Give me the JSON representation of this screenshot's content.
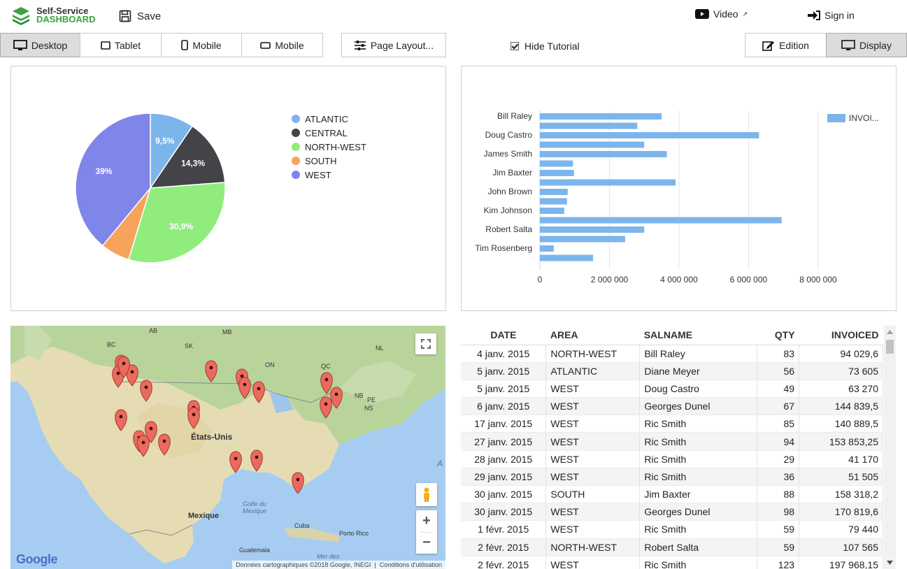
{
  "header": {
    "logo_line1": "Self-Service",
    "logo_line2": "DASHBOARD",
    "save_label": "Save",
    "video_label": "Video",
    "signin_label": "Sign in"
  },
  "toolbar": {
    "desktop": "Desktop",
    "tablet": "Tablet",
    "mobile": "Mobile",
    "mobile2": "Mobile",
    "page_layout": "Page Layout...",
    "hide_tutorial": "Hide Tutorial",
    "edition": "Edition",
    "display": "Display"
  },
  "colors": {
    "accent": "#3aa33f",
    "bar": "#7cb5ec"
  },
  "pie": {
    "legend": [
      {
        "label": "ATLANTIC",
        "color": "#7cb5ec"
      },
      {
        "label": "CENTRAL",
        "color": "#434348"
      },
      {
        "label": "NORTH-WEST",
        "color": "#90ed7d"
      },
      {
        "label": "SOUTH",
        "color": "#f7a35c"
      },
      {
        "label": "WEST",
        "color": "#8085e9"
      }
    ]
  },
  "bar": {
    "legend_label": "INVOI..."
  },
  "chart_data": [
    {
      "type": "pie",
      "categories": [
        "ATLANTIC",
        "CENTRAL",
        "NORTH-WEST",
        "SOUTH",
        "WEST"
      ],
      "values": [
        9.5,
        14.3,
        30.9,
        6.3,
        39
      ],
      "labels": [
        "9,5%",
        "14,3%",
        "30,9%",
        "",
        "39%"
      ]
    },
    {
      "type": "bar",
      "orientation": "horizontal",
      "series": [
        {
          "name": "INVOI...",
          "values": [
            3500000,
            2800000,
            6300000,
            3000000,
            3650000,
            950000,
            980000,
            3900000,
            800000,
            780000,
            700000,
            6950000,
            3000000,
            2450000,
            400000,
            1530000
          ]
        }
      ],
      "row_labels": [
        "Bill Raley",
        "",
        "Doug Castro",
        "",
        "James Smith",
        "",
        "Jim Baxter",
        "",
        "John Brown",
        "",
        "Kim Johnson",
        "",
        "Robert Salta",
        "",
        "Tim Rosenberg",
        ""
      ],
      "xticks": [
        "0",
        "2 000 000",
        "4 000 000",
        "6 000 000",
        "8 000 000"
      ],
      "xlim": [
        0,
        8000000
      ],
      "grid": true,
      "legend_position": "top-right"
    }
  ],
  "map": {
    "labels": [
      {
        "text": "AB"
      },
      {
        "text": "MB"
      },
      {
        "text": "BC"
      },
      {
        "text": "SK"
      },
      {
        "text": "NL"
      },
      {
        "text": "ON"
      },
      {
        "text": "QC"
      },
      {
        "text": "NB"
      },
      {
        "text": "PE"
      },
      {
        "text": "NS"
      },
      {
        "text": "États-Unis"
      },
      {
        "text": "Golfe du Mexique"
      },
      {
        "text": "Mexique"
      },
      {
        "text": "Cuba"
      },
      {
        "text": "Porto Rico"
      },
      {
        "text": "Guatemala"
      },
      {
        "text": "Mer des"
      },
      {
        "text": "A"
      }
    ],
    "attribution": "Données cartographiques ©2018 Google, INEGI",
    "terms": "Conditions d'utilisation",
    "google": "Google",
    "zoom_in": "+",
    "zoom_out": "−"
  },
  "table": {
    "headers": [
      "DATE",
      "AREA",
      "SALNAME",
      "QTY",
      "INVOICED"
    ],
    "rows": [
      [
        "4 janv. 2015",
        "NORTH-WEST",
        "Bill Raley",
        "83",
        "94 029,6"
      ],
      [
        "5 janv. 2015",
        "ATLANTIC",
        "Diane Meyer",
        "56",
        "73 605"
      ],
      [
        "5 janv. 2015",
        "WEST",
        "Doug Castro",
        "49",
        "63 270"
      ],
      [
        "6 janv. 2015",
        "WEST",
        "Georges Dunel",
        "67",
        "144 839,5"
      ],
      [
        "17 janv. 2015",
        "WEST",
        "Ric Smith",
        "85",
        "140 889,5"
      ],
      [
        "27 janv. 2015",
        "WEST",
        "Ric Smith",
        "94",
        "153 853,25"
      ],
      [
        "28 janv. 2015",
        "WEST",
        "Ric Smith",
        "29",
        "41 170"
      ],
      [
        "29 janv. 2015",
        "WEST",
        "Ric Smith",
        "36",
        "51 505"
      ],
      [
        "30 janv. 2015",
        "SOUTH",
        "Jim Baxter",
        "88",
        "158 318,2"
      ],
      [
        "30 janv. 2015",
        "WEST",
        "Georges Dunel",
        "98",
        "170 819,6"
      ],
      [
        "1 févr. 2015",
        "WEST",
        "Ric Smith",
        "59",
        "79 440"
      ],
      [
        "2 févr. 2015",
        "NORTH-WEST",
        "Robert Salta",
        "59",
        "107 565"
      ],
      [
        "2 févr. 2015",
        "WEST",
        "Ric Smith",
        "123",
        "197 968,15"
      ]
    ]
  }
}
